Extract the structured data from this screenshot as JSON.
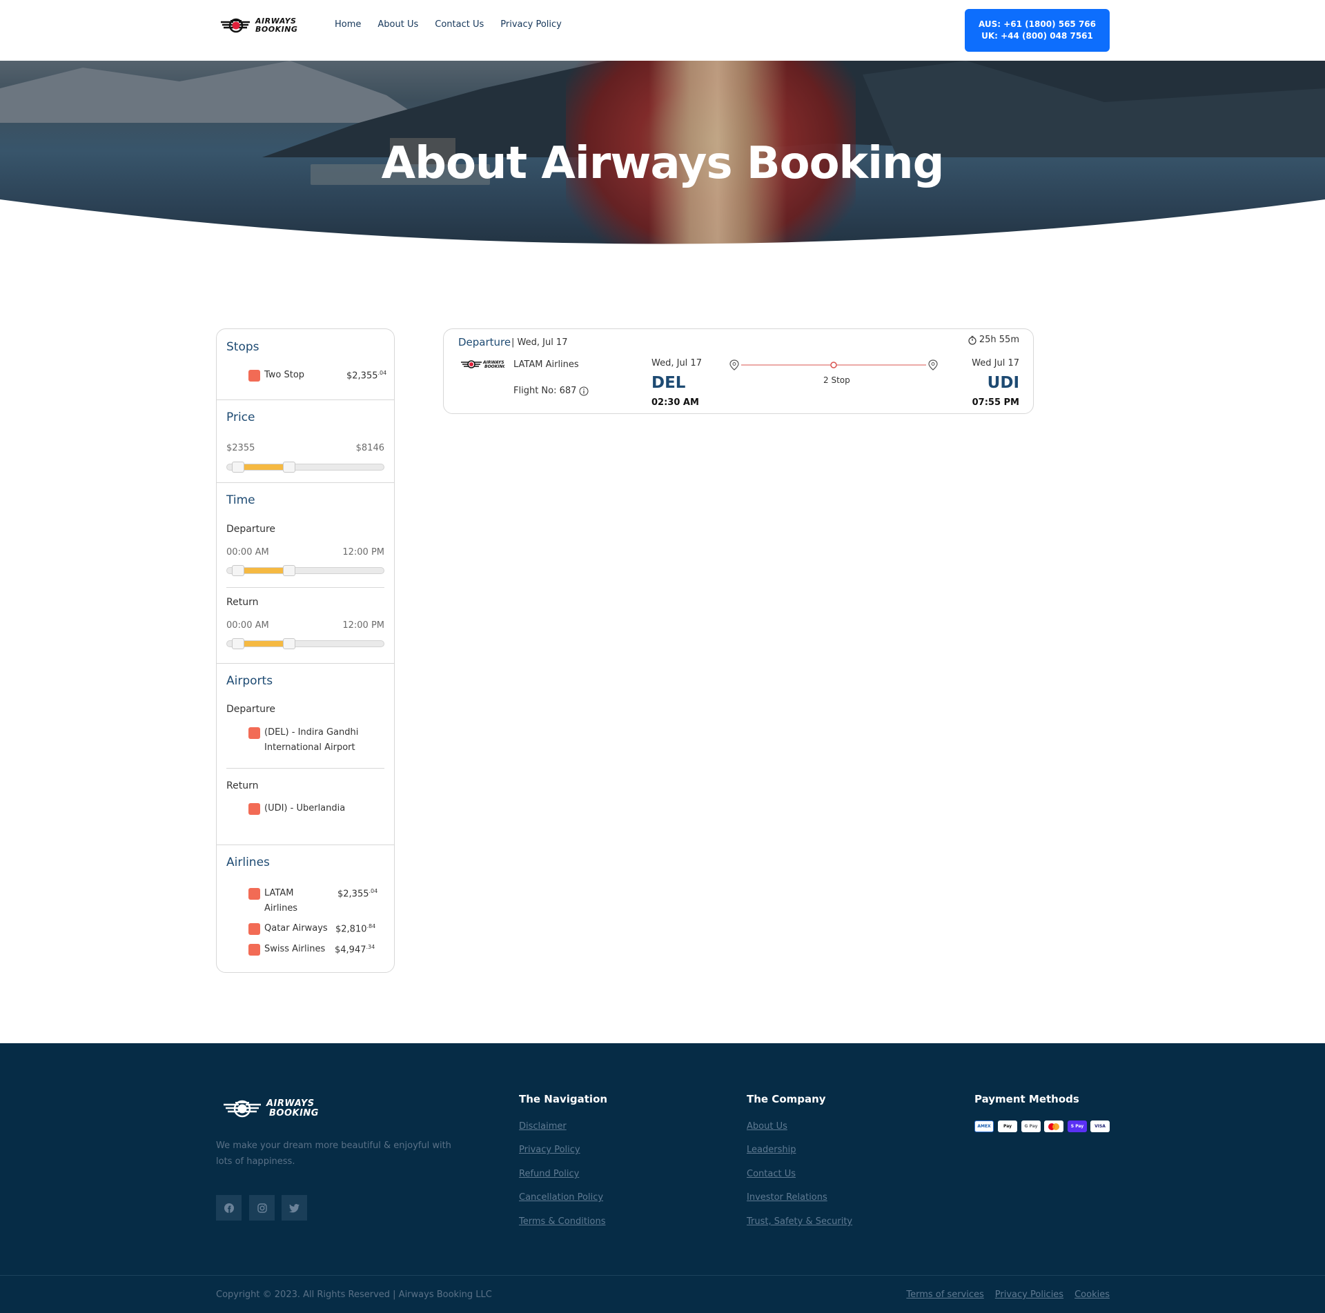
{
  "header": {
    "logo_text_line1": "AIRWAYS",
    "logo_text_line2": "BOOKING",
    "nav": [
      "Home",
      "About Us",
      "Contact Us",
      "Privacy Policy"
    ],
    "phone": "AUS: +61 (1800) 565 766 UK: +44 (800) 048 7561"
  },
  "hero": {
    "title": "About Airways Booking"
  },
  "filters": {
    "stops": {
      "title": "Stops",
      "items": [
        {
          "label": "Two Stop",
          "price": "$2,355",
          "cents": ".04"
        }
      ]
    },
    "price": {
      "title": "Price",
      "min": "$2355",
      "max": "$8146"
    },
    "time": {
      "title": "Time",
      "departure_label": "Departure",
      "departure_min": "00:00 AM",
      "departure_max": "12:00 PM",
      "return_label": "Return",
      "return_min": "00:00 AM",
      "return_max": "12:00 PM"
    },
    "airports": {
      "title": "Airports",
      "departure_label": "Departure",
      "departure_item": "(DEL) - Indira Gandhi International Airport",
      "return_label": "Return",
      "return_item": "(UDI) - Uberlandia"
    },
    "airlines": {
      "title": "Airlines",
      "items": [
        {
          "name": "LATAM Airlines",
          "price": "$2,355",
          "cents": ".04"
        },
        {
          "name": "Qatar Airways",
          "price": "$2,810",
          "cents": ".84"
        },
        {
          "name": "Swiss Airlines",
          "price": "$4,947",
          "cents": ".34"
        }
      ]
    }
  },
  "flight": {
    "departure_label": "Departure",
    "departure_date": "| Wed, Jul 17",
    "duration": "25h 55m",
    "airline": "LATAM Airlines",
    "flight_no": "Flight No: 687",
    "from_date": "Wed, Jul 17",
    "from_code": "DEL",
    "from_time": "02:30 AM",
    "to_date": "Wed Jul 17",
    "to_code": "UDI",
    "to_time": "07:55 PM",
    "stops": "2 Stop"
  },
  "footer": {
    "logo_text_line1": "AIRWAYS",
    "logo_text_line2": "BOOKING",
    "description": "We make your dream more beautiful & enjoyful with lots of happiness.",
    "navigation_title": "The Navigation",
    "navigation_links": [
      "Disclaimer",
      "Privacy Policy",
      "Refund Policy",
      "Cancellation Policy",
      "Terms & Conditions"
    ],
    "company_title": "The Company",
    "company_links": [
      "About Us",
      "Leadership",
      "Contact Us",
      "Investor Relations",
      "Trust, Safety & Security"
    ],
    "payment_title": "Payment Methods",
    "payment_methods": [
      "AMEX",
      "Pay",
      "G Pay",
      "mastercard",
      "S Pay",
      "VISA"
    ],
    "copyright": "Copyright © 2023. All Rights Reserved | Airways Booking LLC",
    "bottom_links": [
      "Terms of services",
      "Privacy Policies",
      "Cookies"
    ]
  },
  "colors": {
    "primary": "#1d4a72",
    "accent_button": "#0d6efd",
    "checkbox": "#f26b55",
    "slider_fill": "#f5b942",
    "footer_bg": "#062c46"
  }
}
